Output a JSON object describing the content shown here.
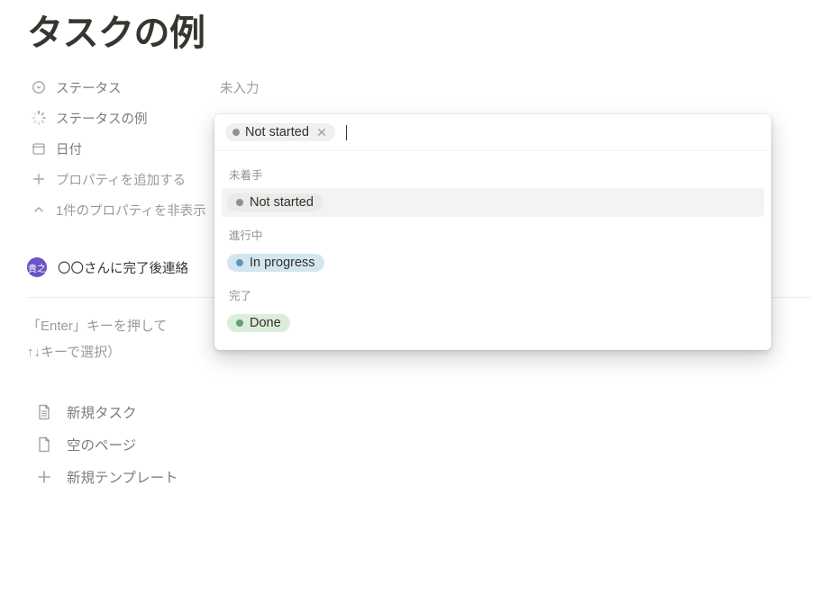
{
  "page_title": "タスクの例",
  "properties": {
    "status": {
      "label": "ステータス",
      "value": "未入力"
    },
    "status_example": {
      "label": "ステータスの例"
    },
    "date": {
      "label": "日付"
    }
  },
  "add_property": "プロパティを追加する",
  "hide_properties": "1件のプロパティを非表示",
  "relation": {
    "avatar_text": "貴之",
    "text": "〇〇さんに完了後連絡"
  },
  "hint_line1": "「Enter」キーを押して",
  "hint_line2": "↑↓キーで選択）",
  "create": {
    "new_task": "新規タスク",
    "empty_page": "空のページ",
    "new_template": "新規テンプレート"
  },
  "dropdown": {
    "selected_chip": "Not started",
    "groups": {
      "not_started": {
        "header": "未着手",
        "option": "Not started"
      },
      "in_progress": {
        "header": "進行中",
        "option": "In progress"
      },
      "done": {
        "header": "完了",
        "option": "Done"
      }
    }
  }
}
